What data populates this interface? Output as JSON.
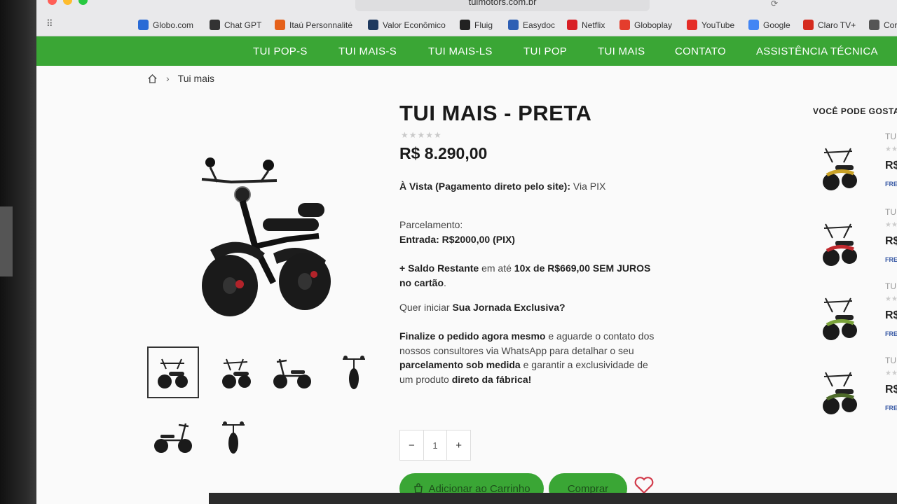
{
  "browser": {
    "url": "tuimotors.com.br",
    "bookmarks": [
      {
        "label": "Globo.com",
        "icon": "globo-icon",
        "color": "#2a6bd6"
      },
      {
        "label": "Chat GPT",
        "icon": "chatgpt-icon",
        "color": "#333333"
      },
      {
        "label": "Itaú Personnalité",
        "icon": "itau-icon",
        "color": "#e5611a"
      },
      {
        "label": "Valor Econômico",
        "icon": "valor-icon",
        "color": "#1f3a5f"
      },
      {
        "label": "Fluig",
        "icon": "fluig-icon",
        "color": "#222222"
      },
      {
        "label": "Easydoc",
        "icon": "easydoc-icon",
        "color": "#2e5fb4"
      },
      {
        "label": "Netflix",
        "icon": "netflix-icon",
        "color": "#d81f26"
      },
      {
        "label": "Globoplay",
        "icon": "globoplay-icon",
        "color": "#e43d2d"
      },
      {
        "label": "YouTube",
        "icon": "youtube-icon",
        "color": "#e52d27"
      },
      {
        "label": "Google",
        "icon": "google-icon",
        "color": "#4285f4"
      },
      {
        "label": "Claro TV+",
        "icon": "claro-icon",
        "color": "#d52b1e"
      },
      {
        "label": "Cor",
        "icon": "globe-icon",
        "color": "#555555"
      }
    ]
  },
  "nav": {
    "items": [
      "TUI POP-S",
      "TUI MAIS-S",
      "TUI MAIS-LS",
      "TUI POP",
      "TUI MAIS",
      "CONTATO",
      "ASSISTÊNCIA TÉCNICA"
    ]
  },
  "breadcrumb": {
    "current": "Tui mais"
  },
  "product": {
    "title": "TUI MAIS - PRETA",
    "rating": 0,
    "price": "R$ 8.290,00",
    "avista_bold": "À Vista (Pagamento direto pelo site):",
    "avista_rest": " Via PIX",
    "parcelamento_label": "Parcelamento:",
    "entrada": "Entrada: R$2000,00 (PIX)",
    "saldo_bold1": "+ Saldo Restante",
    "saldo_mid": " em até ",
    "saldo_bold2": "10x de R$669,00 SEM JUROS no cartão",
    "saldo_end": ".",
    "jornada_pre": "Quer iniciar ",
    "jornada_bold": "Sua Jornada Exclusiva?",
    "final_bold1": "Finalize o pedido agora mesmo",
    "final_t1": " e aguarde o contato dos nossos consultores via WhatsApp para detalhar o seu ",
    "final_bold2": "parcelamento sob medida",
    "final_t2": " e garantir a exclusividade de um produto ",
    "final_bold3": "direto da fábrica!",
    "quantity": "1",
    "qty_minus": "−",
    "qty_plus": "+",
    "add_to_cart": "Adicionar ao Carrinho",
    "buy": "Comprar"
  },
  "side": {
    "title": "VOCÊ PODE GOSTAR",
    "items": [
      {
        "name": "TU",
        "price": "R$",
        "free": "FRE",
        "accent": "#c9a227"
      },
      {
        "name": "TU",
        "price": "R$",
        "free": "FRE",
        "accent": "#c0282d"
      },
      {
        "name": "TUI",
        "price": "R$",
        "free": "FRE",
        "accent": "#7aa33a"
      },
      {
        "name": "TUI",
        "price": "R$",
        "free": "FRE",
        "accent": "#4e6b2a"
      }
    ]
  },
  "colors": {
    "brand_green": "#3aa635",
    "text_dark": "#1a1a1a"
  }
}
